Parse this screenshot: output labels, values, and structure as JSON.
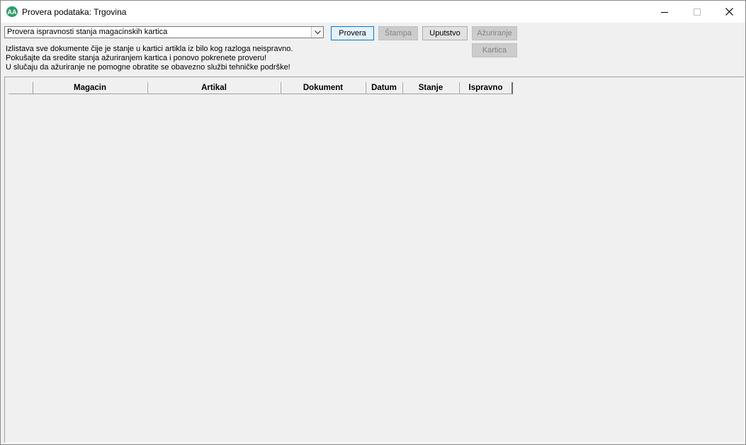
{
  "window": {
    "title": "Provera podataka: Trgovina",
    "app_icon": "app-logo-icon",
    "controls": [
      "minimize-icon",
      "maximize-icon",
      "close-icon"
    ]
  },
  "toolbar": {
    "check_select": {
      "value": "Provera ispravnosti stanja magacinskih kartica"
    },
    "buttons": {
      "provera": "Provera",
      "stampa": "Štampa",
      "uputstvo": "Uputstvo",
      "azuriranje": "Ažuriranje",
      "kartica": "Kartica"
    }
  },
  "description": {
    "line1": "Izlistava sve dokumente čije je stanje u kartici artikla iz bilo kog razloga neispravno.",
    "line2": "Pokušajte da sredite stanja ažuriranjem kartica i ponovo pokrenete proveru!",
    "line3": "U slučaju da ažuriranje ne pomogne obratite se obavezno službi tehničke podrške!"
  },
  "grid": {
    "columns": [
      "Magacin",
      "Artikal",
      "Dokument",
      "Datum",
      "Stanje",
      "Ispravno"
    ],
    "rows": []
  },
  "colors": {
    "primary_button_border": "#0078d7",
    "primary_button_bg": "#e5f1fb",
    "disabled_text": "#838383",
    "window_bg": "#f0f0f0"
  }
}
